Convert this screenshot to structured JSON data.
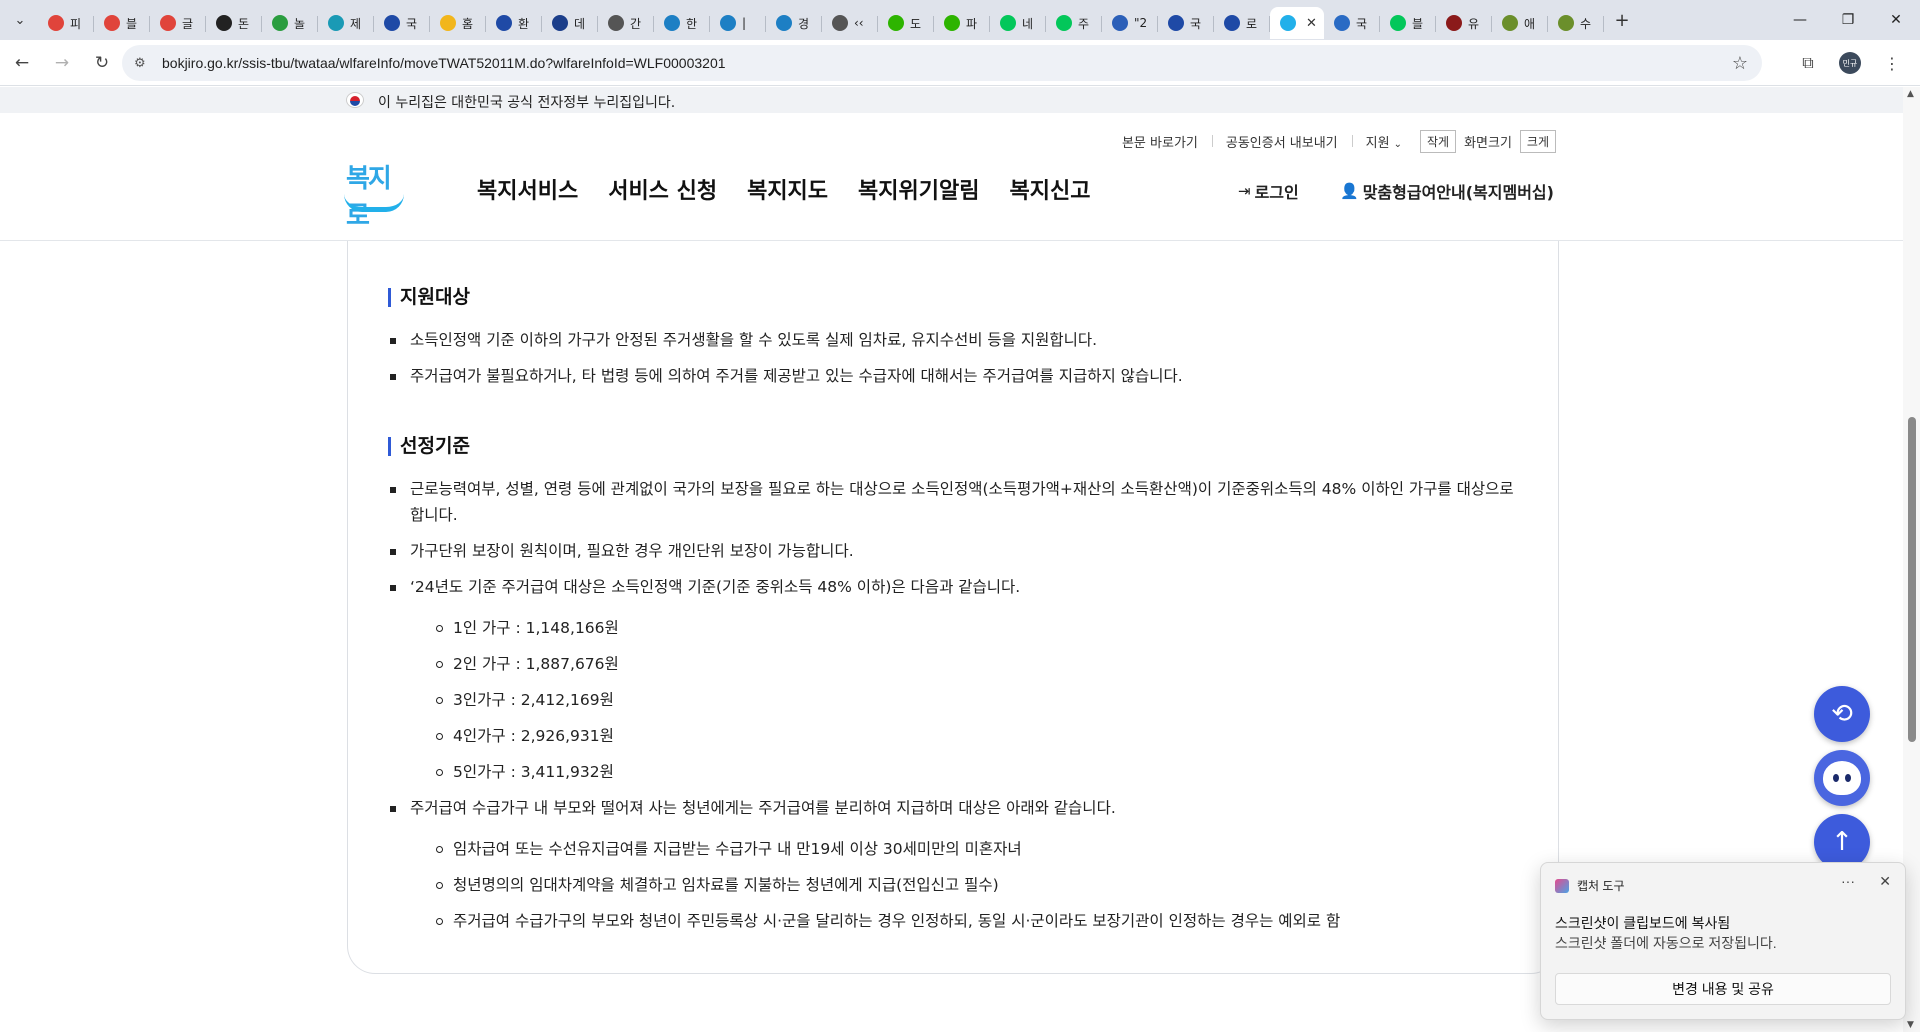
{
  "browser": {
    "tabs": [
      {
        "icon": "trello-red-icon",
        "color": "#e0443b",
        "label": "피"
      },
      {
        "icon": "trello-red-icon",
        "color": "#e0443b",
        "label": "블"
      },
      {
        "icon": "trello-red-icon",
        "color": "#e0443b",
        "label": "글"
      },
      {
        "icon": "openai-icon",
        "color": "#222222",
        "label": "돈"
      },
      {
        "icon": "px-icon",
        "color": "#2a9d3f",
        "label": "놀"
      },
      {
        "icon": "hancom-icon",
        "color": "#1a9ab5",
        "label": "제"
      },
      {
        "icon": "korea-gov-icon",
        "color": "#1f4aa6",
        "label": "국"
      },
      {
        "icon": "drive-icon",
        "color": "#f2b61c",
        "label": "홈"
      },
      {
        "icon": "korea-gov-icon",
        "color": "#1f4aa6",
        "label": "환"
      },
      {
        "icon": "d-icon",
        "color": "#1b3e8a",
        "label": "데"
      },
      {
        "icon": "globe-icon",
        "color": "#555555",
        "label": "간"
      },
      {
        "icon": "blue-globe-icon",
        "color": "#1d7fc4",
        "label": "한"
      },
      {
        "icon": "blue-globe-icon",
        "color": "#1d7fc4",
        "label": "|"
      },
      {
        "icon": "blue-globe-icon",
        "color": "#1d7fc4",
        "label": "경"
      },
      {
        "icon": "globe-icon",
        "color": "#555555",
        "label": "‹‹"
      },
      {
        "icon": "naver-blog-icon",
        "color": "#2db400",
        "label": "도"
      },
      {
        "icon": "naver-blog-icon",
        "color": "#2db400",
        "label": "파"
      },
      {
        "icon": "naver-icon",
        "color": "#03c75a",
        "label": "네"
      },
      {
        "icon": "naver-icon",
        "color": "#03c75a",
        "label": "주"
      },
      {
        "icon": "word-icon",
        "color": "#2b5fb8",
        "label": "\"2"
      },
      {
        "icon": "korea-gov-icon",
        "color": "#1f4aa6",
        "label": "국"
      },
      {
        "icon": "korea-gov-icon",
        "color": "#1f4aa6",
        "label": "로"
      },
      {
        "icon": "bokjiro-icon",
        "color": "#22b0ea",
        "label": "",
        "active": true
      },
      {
        "icon": "house-icon",
        "color": "#2a6bc4",
        "label": "국"
      },
      {
        "icon": "naver-icon",
        "color": "#03c75a",
        "label": "블"
      },
      {
        "icon": "youtube-icon",
        "color": "#8b1a1a",
        "label": "유"
      },
      {
        "icon": "leaf-icon",
        "color": "#6b8f2b",
        "label": "애"
      },
      {
        "icon": "leaf-icon",
        "color": "#6b8f2b",
        "label": "수"
      }
    ],
    "url": "bokjiro.go.kr/ssis-tbu/twataa/wlfareInfo/moveTWAT52011M.do?wlfareInfoId=WLF00003201",
    "profile_label": "민규"
  },
  "gov_banner": "이 누리집은 대한민국 공식 전자정부 누리집입니다.",
  "header": {
    "util_links": [
      "본문 바로가기",
      "공동인증서 내보내기",
      "지원"
    ],
    "size_small": "작게",
    "size_label": "화면크기",
    "size_large": "크게",
    "logo_text": "복지로",
    "gnb": [
      "복지서비스",
      "서비스 신청",
      "복지지도",
      "복지위기알림",
      "복지신고"
    ],
    "login": "로그인",
    "member": "맞춤형급여안내(복지멤버십)"
  },
  "content": {
    "section1_title": "지원대상",
    "section1_items": [
      "소득인정액 기준 이하의 가구가 안정된 주거생활을 할 수 있도록 실제 임차료, 유지수선비 등을 지원합니다.",
      "주거급여가 불필요하거나, 타 법령 등에 의하여 주거를 제공받고 있는 수급자에 대해서는 주거급여를 지급하지 않습니다."
    ],
    "section2_title": "선정기준",
    "criteria_1": "근로능력여부, 성별, 연령 등에 관계없이 국가의 보장을 필요로 하는 대상으로 소득인정액(소득평가액+재산의 소득환산액)이 기준중위소득의 48% 이하인 가구를 대상으로 합니다.",
    "criteria_2": "가구단위 보장이 원칙이며, 필요한 경우 개인단위 보장이 가능합니다.",
    "criteria_3": "‘24년도 기준 주거급여 대상은 소득인정액 기준(기준 중위소득 48% 이하)은 다음과 같습니다.",
    "household_limits": [
      "1인 가구 : 1,148,166원",
      "2인 가구 : 1,887,676원",
      "3인가구 : 2,412,169원",
      "4인가구 : 2,926,931원",
      "5인가구 : 3,411,932원"
    ],
    "criteria_4": "주거급여 수급가구 내 부모와 떨어져 사는 청년에게는 주거급여를 분리하여 지급하며 대상은 아래와 같습니다.",
    "youth_items": [
      "임차급여 또는 수선유지급여를 지급받는 수급가구 내 만19세 이상 30세미만의 미혼자녀",
      "청년명의의 임대차계약을 체결하고 임차료를 지불하는 청년에게 지급(전입신고 필수)",
      "주거급여 수급가구의 부모와 청년이 주민등록상 시·군을 달리하는 경우 인정하되, 동일 시·군이라도 보장기관이 인정하는 경우는 예외로 함"
    ]
  },
  "toast": {
    "app_name": "캡처 도구",
    "line1": "스크린샷이 클립보드에 복사됨",
    "line2": "스크린샷 폴더에 자동으로 저장됩니다.",
    "button": "변경 내용 및 공유"
  },
  "colors": {
    "accent": "#3d5bdc",
    "section_bar": "#2f5ad6",
    "logo": "#22b0ea"
  }
}
